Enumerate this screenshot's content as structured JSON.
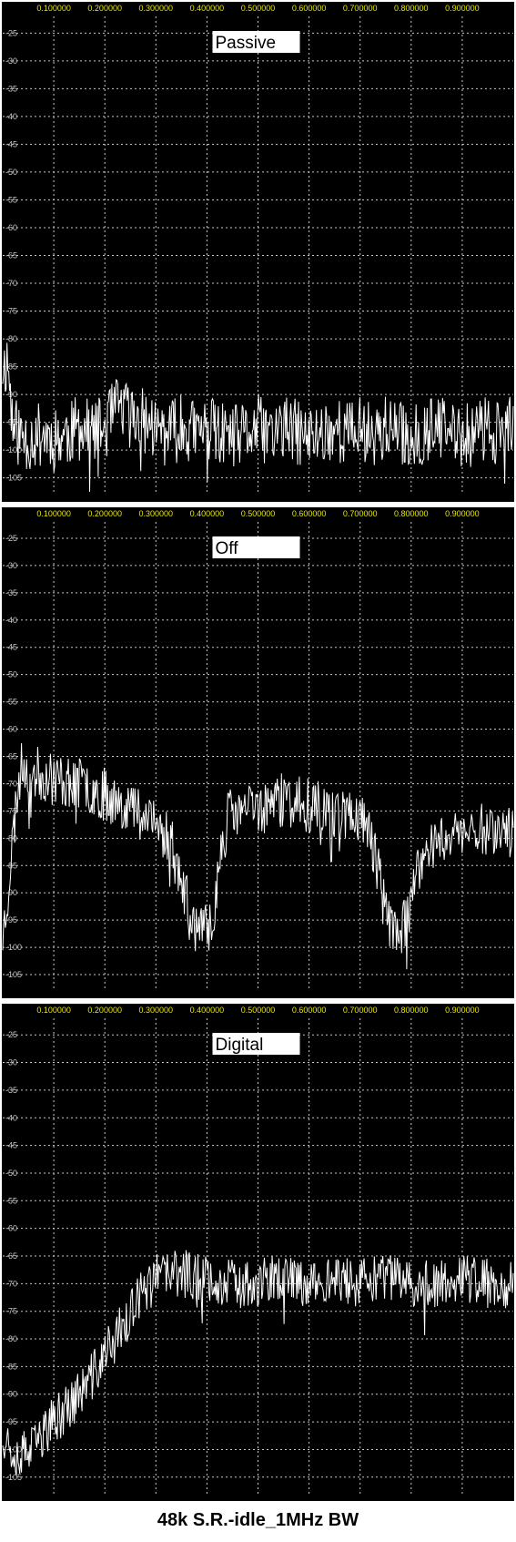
{
  "caption": "48k S.R.-idle_1MHz BW",
  "colors": {
    "background": "#000000",
    "frame": "#ffffff",
    "grid": "#c8c8c8",
    "x_tick_labels": "#e6e600",
    "y_tick_labels": "#c8c8c8",
    "trace": "#ffffff",
    "label_box": "#ffffff",
    "label_text": "#000000"
  },
  "chart_data": [
    {
      "type": "line",
      "title": "Passive",
      "x_ticks": [
        "0.100000",
        "0.200000",
        "0.300000",
        "0.400000",
        "0.500000",
        "0.600000",
        "0.700000",
        "0.800000",
        "0.900000"
      ],
      "y_ticks": [
        "-25",
        "-30",
        "-35",
        "-40",
        "-45",
        "-50",
        "-55",
        "-60",
        "-65",
        "-70",
        "-75",
        "-80",
        "-85",
        "-90",
        "-95",
        "-100",
        "-105"
      ],
      "xlim": [
        0,
        1.0
      ],
      "ylim": [
        -108,
        -22
      ],
      "grid": true,
      "series": [
        {
          "x": [
            0,
            0.01,
            0.02,
            0.03,
            0.05,
            0.08,
            0.1,
            0.13,
            0.15,
            0.18,
            0.2,
            0.22,
            0.23,
            0.24,
            0.25,
            0.28,
            0.3,
            0.32,
            0.35,
            0.38,
            0.4,
            0.42,
            0.45,
            0.48,
            0.5,
            0.52,
            0.55,
            0.58,
            0.6,
            0.62,
            0.65,
            0.68,
            0.7,
            0.72,
            0.75,
            0.78,
            0.8,
            0.82,
            0.85,
            0.88,
            0.9,
            0.92,
            0.95,
            0.98,
            1.0
          ],
          "y": [
            -85,
            -84,
            -96,
            -97,
            -98,
            -97,
            -98,
            -97,
            -96,
            -97,
            -96,
            -93,
            -92,
            -93,
            -94,
            -95,
            -96,
            -97,
            -96,
            -97,
            -96,
            -97,
            -98,
            -97,
            -96,
            -97,
            -96,
            -97,
            -98,
            -97,
            -96,
            -97,
            -96,
            -97,
            -96,
            -97,
            -98,
            -97,
            -96,
            -97,
            -98,
            -97,
            -96,
            -97,
            -96
          ],
          "noise": 6,
          "seed": 11
        }
      ]
    },
    {
      "type": "line",
      "title": "Off",
      "x_ticks": [
        "0.100000",
        "0.200000",
        "0.300000",
        "0.400000",
        "0.500000",
        "0.600000",
        "0.700000",
        "0.800000",
        "0.900000"
      ],
      "y_ticks": [
        "-25",
        "-30",
        "-35",
        "-40",
        "-45",
        "-50",
        "-55",
        "-60",
        "-65",
        "-70",
        "-75",
        "-80",
        "-85",
        "-90",
        "-95",
        "-100",
        "-105"
      ],
      "xlim": [
        0,
        1.0
      ],
      "ylim": [
        -108,
        -22
      ],
      "grid": true,
      "series": [
        {
          "x": [
            0,
            0.01,
            0.02,
            0.03,
            0.04,
            0.06,
            0.1,
            0.15,
            0.2,
            0.25,
            0.28,
            0.3,
            0.33,
            0.35,
            0.37,
            0.39,
            0.41,
            0.42,
            0.44,
            0.5,
            0.55,
            0.6,
            0.65,
            0.7,
            0.72,
            0.74,
            0.75,
            0.77,
            0.79,
            0.8,
            0.82,
            0.85,
            0.9,
            0.95,
            1.0
          ],
          "y": [
            -98,
            -90,
            -80,
            -70,
            -66,
            -68,
            -69,
            -70,
            -72,
            -74,
            -76,
            -78,
            -80,
            -88,
            -95,
            -98,
            -95,
            -88,
            -76,
            -74,
            -73,
            -74,
            -75,
            -76,
            -79,
            -88,
            -94,
            -97,
            -96,
            -92,
            -84,
            -80,
            -79,
            -78,
            -79
          ],
          "noise": 5,
          "seed": 23
        }
      ]
    },
    {
      "type": "line",
      "title": "Digital",
      "x_ticks": [
        "0.100000",
        "0.200000",
        "0.300000",
        "0.400000",
        "0.500000",
        "0.600000",
        "0.700000",
        "0.800000",
        "0.900000"
      ],
      "y_ticks": [
        "-25",
        "-30",
        "-35",
        "-40",
        "-45",
        "-50",
        "-55",
        "-60",
        "-65",
        "-70",
        "-75",
        "-80",
        "-85",
        "-90",
        "-95",
        "-100",
        "-105"
      ],
      "xlim": [
        0,
        1.0
      ],
      "ylim": [
        -108,
        -22
      ],
      "grid": true,
      "series": [
        {
          "x": [
            0,
            0.02,
            0.04,
            0.06,
            0.08,
            0.1,
            0.12,
            0.14,
            0.16,
            0.18,
            0.2,
            0.22,
            0.24,
            0.26,
            0.28,
            0.3,
            0.35,
            0.4,
            0.45,
            0.5,
            0.55,
            0.6,
            0.65,
            0.7,
            0.75,
            0.8,
            0.85,
            0.9,
            0.95,
            1.0
          ],
          "y": [
            -97,
            -100,
            -101,
            -100,
            -97,
            -95,
            -93,
            -91,
            -89,
            -86,
            -83,
            -80,
            -77,
            -74,
            -71,
            -69,
            -68,
            -69,
            -70,
            -70,
            -69,
            -70,
            -69,
            -70,
            -69,
            -70,
            -70,
            -69,
            -70,
            -70
          ],
          "noise": 4.5,
          "seed": 37
        }
      ]
    }
  ]
}
